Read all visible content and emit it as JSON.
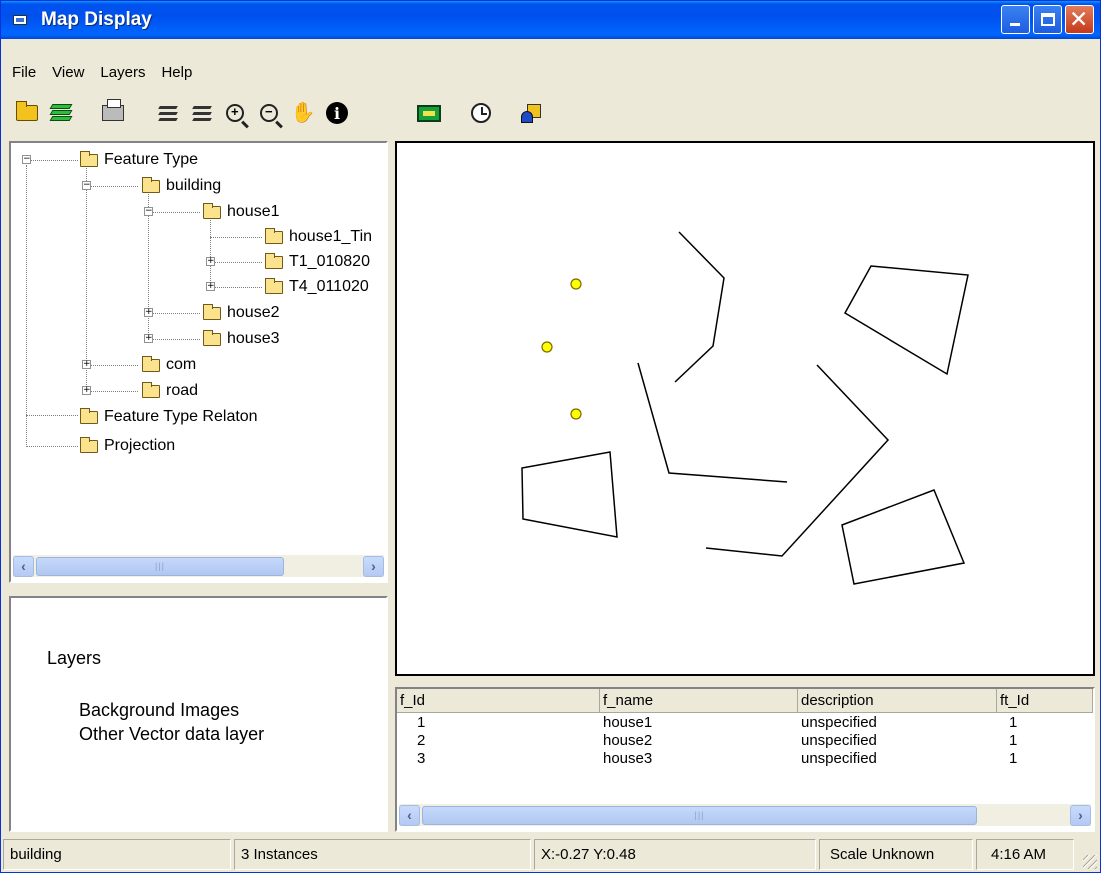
{
  "window": {
    "title": "Map Display"
  },
  "menu": [
    "File",
    "View",
    "Layers",
    "Help"
  ],
  "toolbar": {
    "icons": [
      "open-folder-icon",
      "layers-icon",
      "print-icon",
      "add-layer-icon",
      "remove-layer-icon",
      "zoom-in-icon",
      "zoom-out-icon",
      "pan-hand-icon",
      "info-icon",
      "label-icon",
      "clock-icon",
      "shapes-icon"
    ]
  },
  "tree": {
    "nodes": [
      {
        "label": "Feature Type",
        "expander": "minus"
      },
      {
        "label": "building",
        "expander": "minus"
      },
      {
        "label": "house1",
        "expander": "minus"
      },
      {
        "label": "house1_Tin",
        "expander": ""
      },
      {
        "label": "T1_010820",
        "expander": "plus"
      },
      {
        "label": "T4_011020",
        "expander": "plus"
      },
      {
        "label": "house2",
        "expander": "plus"
      },
      {
        "label": "house3",
        "expander": "plus"
      },
      {
        "label": "com",
        "expander": "plus"
      },
      {
        "label": "road",
        "expander": "plus"
      },
      {
        "label": "Feature Type Relaton",
        "expander": ""
      },
      {
        "label": "Projection",
        "expander": ""
      }
    ]
  },
  "layers": {
    "title": "Layers",
    "items": [
      "Background Images",
      "Other Vector data layer"
    ]
  },
  "table": {
    "columns": [
      "f_Id",
      "f_name",
      "description",
      "ft_Id"
    ],
    "rows": [
      [
        "1",
        "house1",
        "unspecified",
        "1"
      ],
      [
        "2",
        "house2",
        "unspecified",
        "1"
      ],
      [
        "3",
        "house3",
        "unspecified",
        "1"
      ]
    ]
  },
  "status": {
    "feature": "building",
    "instances": "3 Instances",
    "coords": "X:-0.27 Y:0.48",
    "scale": "Scale Unknown",
    "time": "4:16 AM"
  },
  "colors": {
    "titlebar": "#0054e3",
    "point_fill": "#ffff00",
    "window_bg": "#ece9d8"
  }
}
